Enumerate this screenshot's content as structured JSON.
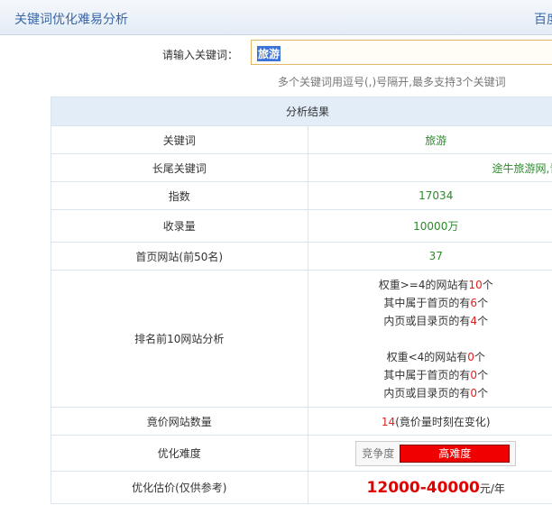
{
  "header": {
    "title": "关键词优化难易分析",
    "right_text": "百度"
  },
  "search": {
    "label": "请输入关键词：",
    "value": "旅游",
    "hint": "多个关键词用逗号(,)号隔开,最多支持3个关键词"
  },
  "table": {
    "caption": "分析结果",
    "rows": {
      "keyword": {
        "label": "关键词",
        "value": "旅游"
      },
      "longtail": {
        "label": "长尾关键词",
        "value": "途牛旅游网,青岛旅游攻略,厦门旅游攻略"
      },
      "index": {
        "label": "指数",
        "value": "17034"
      },
      "indexed": {
        "label": "收录量",
        "value": "10000万"
      },
      "homepage": {
        "label": "首页网站(前50名)",
        "value": "37"
      },
      "top10": {
        "label": "排名前10网站分析",
        "lines": [
          {
            "pre": "权重>=4的网站有",
            "num": "10",
            "post": "个"
          },
          {
            "pre": "其中属于首页的有",
            "num": "6",
            "post": "个"
          },
          {
            "pre": "内页或目录页的有",
            "num": "4",
            "post": "个"
          },
          {
            "pre": "权重<4的网站有",
            "num": "0",
            "post": "个"
          },
          {
            "pre": "其中属于首页的有",
            "num": "0",
            "post": "个"
          },
          {
            "pre": "内页或目录页的有",
            "num": "0",
            "post": "个"
          }
        ]
      },
      "bidding": {
        "label": "竟价网站数量",
        "num": "14",
        "note": "(竟价量时刻在变化)"
      },
      "difficulty": {
        "label": "优化难度",
        "meter_label": "竞争度",
        "level": "高难度",
        "level_color": "#f00000"
      },
      "price": {
        "label": "优化估价(仅供参考)",
        "value": "12000-40000",
        "unit": "元/年"
      }
    }
  }
}
